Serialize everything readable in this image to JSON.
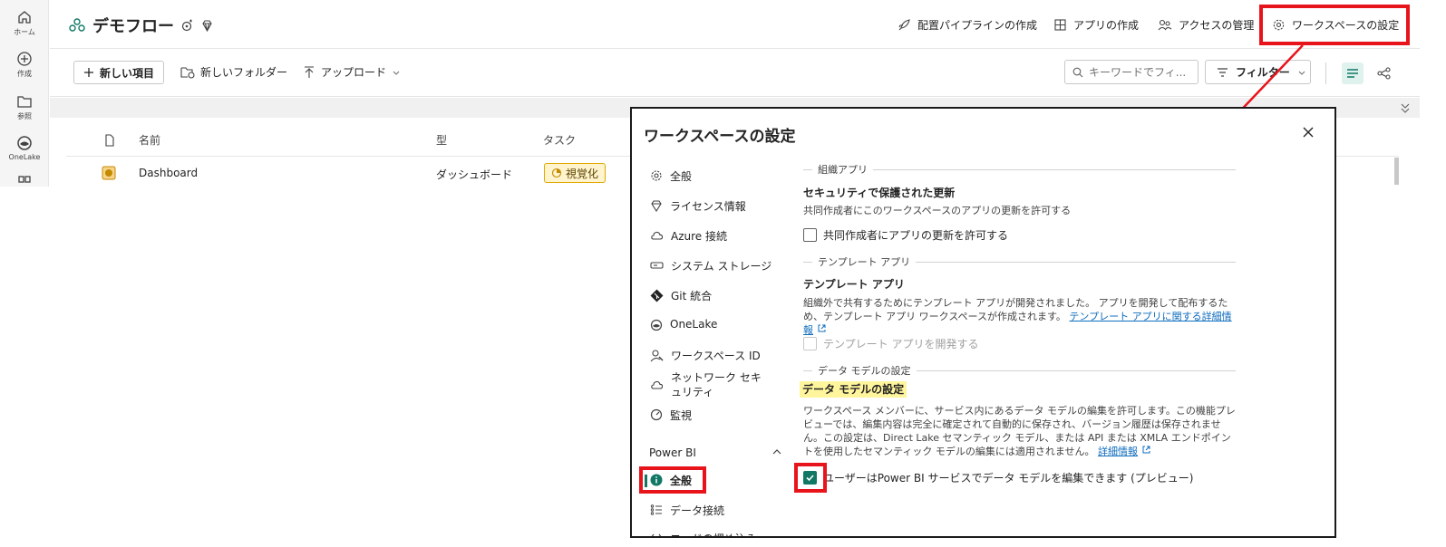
{
  "rail": {
    "items": [
      {
        "label": "ホーム",
        "icon": "home-icon"
      },
      {
        "label": "作成",
        "icon": "create-icon"
      },
      {
        "label": "参照",
        "icon": "browse-icon"
      },
      {
        "label": "OneLake",
        "icon": "onelake-icon"
      }
    ]
  },
  "header": {
    "workspace_name": "デモフロー",
    "pipeline_label": "配置パイプラインの作成",
    "app_label": "アプリの作成",
    "access_label": "アクセスの管理",
    "settings_label": "ワークスペースの設定"
  },
  "toolbar": {
    "new_item": "新しい項目",
    "new_folder": "新しいフォルダー",
    "upload": "アップロード",
    "search_placeholder": "キーワードでフィ...",
    "filter": "フィルター"
  },
  "table": {
    "columns": [
      "名前",
      "型",
      "タスク"
    ],
    "rows": [
      {
        "name": "Dashboard",
        "type": "ダッシュボード",
        "task": "視覚化"
      }
    ]
  },
  "dialog": {
    "title": "ワークスペースの設定",
    "nav": [
      {
        "label": "全般",
        "icon": "gear-icon"
      },
      {
        "label": "ライセンス情報",
        "icon": "diamond-icon"
      },
      {
        "label": "Azure 接続",
        "icon": "cloud-icon"
      },
      {
        "label": "システム ストレージ",
        "icon": "storage-icon"
      },
      {
        "label": "Git 統合",
        "icon": "git-icon"
      },
      {
        "label": "OneLake",
        "icon": "onelake-icon"
      },
      {
        "label": "ワークスペース ID",
        "icon": "identity-icon"
      },
      {
        "label": "ネットワーク セキュリティ",
        "icon": "network-icon"
      },
      {
        "label": "監視",
        "icon": "monitor-icon"
      }
    ],
    "powerbi_section": "Power BI",
    "powerbi_nav": [
      {
        "label": "全般",
        "icon": "info-icon"
      },
      {
        "label": "データ接続",
        "icon": "list-icon"
      },
      {
        "label": "コードの埋め込み",
        "icon": "code-icon"
      }
    ],
    "content": {
      "org_app_section": "組織アプリ",
      "org_app_title": "セキュリティで保護された更新",
      "org_app_desc": "共同作成者にこのワークスペースのアプリの更新を許可する",
      "org_app_checkbox": "共同作成者にアプリの更新を許可する",
      "template_section": "テンプレート アプリ",
      "template_title": "テンプレート アプリ",
      "template_desc": "組織外で共有するためにテンプレート アプリが開発されました。 アプリを開発して配布するため、テンプレート アプリ ワークスペースが作成されます。",
      "template_link": "テンプレート アプリに関する詳細情報",
      "template_checkbox": "テンプレート アプリを開発する",
      "datamodel_section": "データ モデルの設定",
      "datamodel_title": "データ モデルの設定",
      "datamodel_desc": "ワークスペース メンバーに、サービス内にあるデータ モデルの編集を許可します。この機能プレビューでは、編集内容は完全に確定されて自動的に保存され、バージョン履歴は保存されません。この設定は、Direct Lake セマンティック モデル、または API または XMLA エンドポイントを使用したセマンティック モデルの編集には適用されません。",
      "datamodel_link": "詳細情報",
      "datamodel_checkbox": "ユーザーはPower BI サービスでデータ モデルを編集できます (プレビュー)",
      "datamodel_checked": true
    }
  },
  "colors": {
    "accent": "#117865",
    "annotation": "#e8141b",
    "link": "#0f6cbd",
    "highlight": "#fff59d"
  }
}
